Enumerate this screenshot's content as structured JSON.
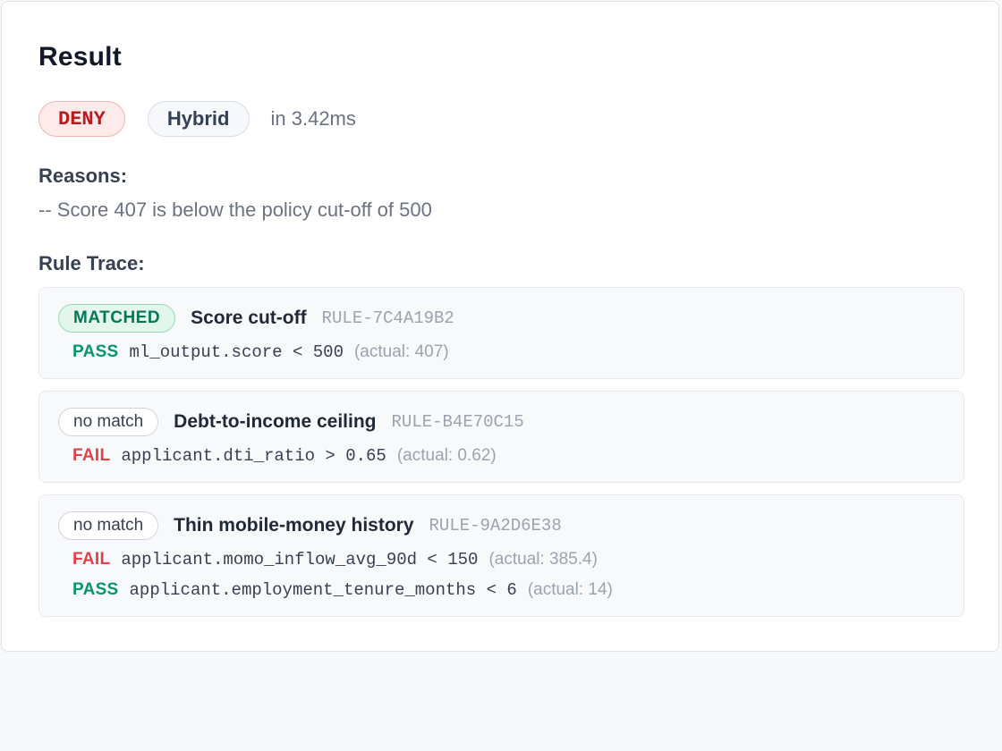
{
  "result": {
    "title": "Result",
    "decision": "DENY",
    "mode": "Hybrid",
    "latency": "in 3.42ms",
    "reasons_label": "Reasons:",
    "reasons": [
      "-- Score 407 is below the policy cut-off of 500"
    ],
    "trace_label": "Rule Trace:",
    "colors": {
      "deny": "#b91c1c",
      "pass": "#059669",
      "fail": "#e0414b",
      "matched": "#047857"
    }
  },
  "rules": [
    {
      "status": "MATCHED",
      "name": "Score cut-off",
      "id": "RULE-7C4A19B2",
      "conditions": [
        {
          "verdict": "PASS",
          "expr": "ml_output.score < 500",
          "actual": "(actual: 407)"
        }
      ]
    },
    {
      "status": "no match",
      "name": "Debt-to-income ceiling",
      "id": "RULE-B4E70C15",
      "conditions": [
        {
          "verdict": "FAIL",
          "expr": "applicant.dti_ratio > 0.65",
          "actual": "(actual: 0.62)"
        }
      ]
    },
    {
      "status": "no match",
      "name": "Thin mobile-money history",
      "id": "RULE-9A2D6E38",
      "conditions": [
        {
          "verdict": "FAIL",
          "expr": "applicant.momo_inflow_avg_90d < 150",
          "actual": "(actual: 385.4)"
        },
        {
          "verdict": "PASS",
          "expr": "applicant.employment_tenure_months < 6",
          "actual": "(actual: 14)"
        }
      ]
    }
  ]
}
